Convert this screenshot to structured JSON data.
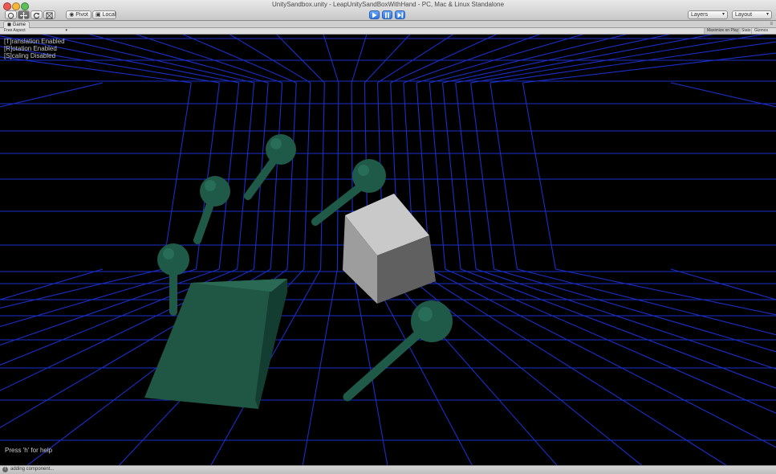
{
  "window": {
    "title": "UnitySandbox.unity - LeapUnitySandBoxWithHand - PC, Mac & Linux Standalone"
  },
  "toolbar": {
    "pivot_label": "Pivot",
    "local_label": "Local",
    "layers_label": "Layers",
    "layout_label": "Layout"
  },
  "game_panel": {
    "tab_label": "Game",
    "aspect_label": "Free Aspect",
    "maximize_label": "Maximize on Play",
    "stats_label": "Stats",
    "gizmos_label": "Gizmos"
  },
  "overlay": {
    "translation": "[T]ranslation Enabled",
    "rotation": "[R]otation Enabled",
    "scaling": "[S]caling Disabled",
    "help": "Press 'h' for help"
  },
  "status": {
    "message": "adding component..."
  },
  "colors": {
    "grid": "#1b2fc8",
    "finger": "#1f5a48",
    "palm": "#225a49",
    "cube_light": "#c9c9c9",
    "cube_mid": "#9d9d9d",
    "cube_dark": "#606060",
    "play_accent": "#3a7cf0"
  }
}
